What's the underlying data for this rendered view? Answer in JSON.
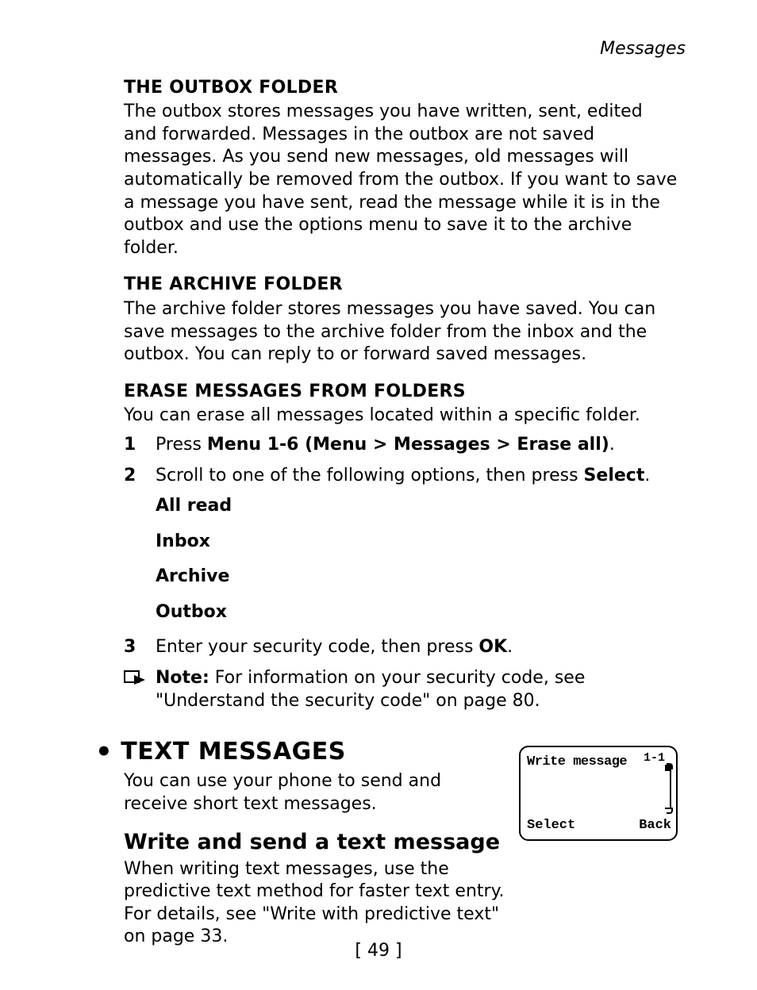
{
  "header": {
    "running_title": "Messages"
  },
  "sections": {
    "outbox": {
      "title": "THE OUTBOX FOLDER",
      "body": "The outbox stores messages you have written, sent, edited and forwarded. Messages in the outbox are not saved messages. As you send new messages, old messages will automatically be removed from the outbox. If you want to save a message you have sent, read the message while it is in the outbox and use the options menu to save it to the archive folder."
    },
    "archive": {
      "title": "THE ARCHIVE FOLDER",
      "body": "The archive folder stores messages you have saved. You can save messages to the archive folder from the inbox and the outbox. You can reply to or forward saved messages."
    },
    "erase": {
      "title": "ERASE MESSAGES FROM FOLDERS",
      "intro": "You can erase all messages located within a specific folder.",
      "steps": {
        "s1_pre": "Press ",
        "s1_bold": "Menu 1-6 (Menu > Messages > Erase all)",
        "s1_post": ".",
        "s2_pre": "Scroll to one of the following options, then press ",
        "s2_bold": "Select",
        "s2_post": ".",
        "options": {
          "o1": "All read",
          "o2": "Inbox",
          "o3": "Archive",
          "o4": "Outbox"
        },
        "s3_pre": "Enter your security code, then press ",
        "s3_bold": "OK",
        "s3_post": "."
      },
      "note_label": "Note:",
      "note_body": " For information on your security code, see \"Understand the security code\" on page 80."
    },
    "text_messages": {
      "bullet": "•",
      "title": "TEXT MESSAGES",
      "intro": "You can use your phone to send and receive short text messages.",
      "write_title": "Write and send a text message",
      "write_body": "When writing text messages, use the predictive text method for faster text entry. For details, see \"Write with predictive text\" on page 33."
    }
  },
  "phone_screen": {
    "title": "Write message",
    "index": "1-1",
    "softkey_left": "Select",
    "softkey_right": "Back"
  },
  "list_numbers": {
    "n1": "1",
    "n2": "2",
    "n3": "3"
  },
  "page_number": "[ 49 ]"
}
